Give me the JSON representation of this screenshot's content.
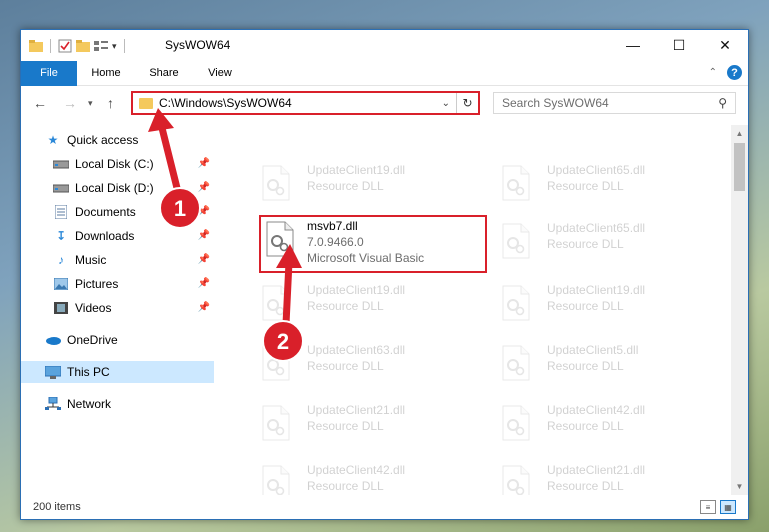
{
  "window": {
    "title": "SysWOW64",
    "controls": [
      "minimize",
      "maximize",
      "close"
    ]
  },
  "ribbon": {
    "tabs": [
      {
        "label": "File",
        "active": true
      },
      {
        "label": "Home"
      },
      {
        "label": "Share"
      },
      {
        "label": "View"
      }
    ],
    "help_label": "?"
  },
  "address": {
    "path": "C:\\Windows\\SysWOW64",
    "highlight_color": "#d9202a"
  },
  "search": {
    "placeholder": "Search SysWOW64"
  },
  "sidebar": {
    "items": [
      {
        "label": "Quick access",
        "icon": "star-icon",
        "pinned": false
      },
      {
        "label": "Local Disk (C:)",
        "icon": "drive-icon",
        "pinned": true
      },
      {
        "label": "Local Disk (D:)",
        "icon": "drive-icon",
        "pinned": true
      },
      {
        "label": "Documents",
        "icon": "documents-icon",
        "pinned": true
      },
      {
        "label": "Downloads",
        "icon": "download-icon",
        "pinned": true
      },
      {
        "label": "Music",
        "icon": "music-icon",
        "pinned": true
      },
      {
        "label": "Pictures",
        "icon": "pictures-icon",
        "pinned": true
      },
      {
        "label": "Videos",
        "icon": "videos-icon",
        "pinned": true
      },
      {
        "label": "OneDrive",
        "icon": "cloud-icon",
        "pinned": false
      },
      {
        "label": "This PC",
        "icon": "computer-icon",
        "pinned": false,
        "selected": true
      },
      {
        "label": "Network",
        "icon": "network-icon",
        "pinned": false
      }
    ]
  },
  "files": {
    "left_column": [
      {
        "name": "UpdateClient19.dll",
        "desc": "Resource DLL"
      },
      {
        "name": "msvb7.dll",
        "desc": "7.0.9466.0",
        "desc2": "Microsoft Visual Basic",
        "highlighted": true
      },
      {
        "name": "UpdateClient19.dll",
        "desc": "Resource DLL"
      },
      {
        "name": "UpdateClient63.dll",
        "desc": "Resource DLL"
      },
      {
        "name": "UpdateClient21.dll",
        "desc": "Resource DLL"
      },
      {
        "name": "UpdateClient42.dll",
        "desc": "Resource DLL"
      }
    ],
    "right_column": [
      {
        "name": "UpdateClient65.dll",
        "desc": "Resource DLL"
      },
      {
        "name": "UpdateClient65.dll",
        "desc": "Resource DLL"
      },
      {
        "name": "UpdateClient19.dll",
        "desc": "Resource DLL"
      },
      {
        "name": "UpdateClient5.dll",
        "desc": "Resource DLL"
      },
      {
        "name": "UpdateClient42.dll",
        "desc": "Resource DLL"
      },
      {
        "name": "UpdateClient21.dll",
        "desc": "Resource DLL"
      }
    ]
  },
  "status": {
    "item_count": "200 items"
  },
  "annotations": {
    "step1": "1",
    "step2": "2",
    "color": "#d9202a"
  }
}
